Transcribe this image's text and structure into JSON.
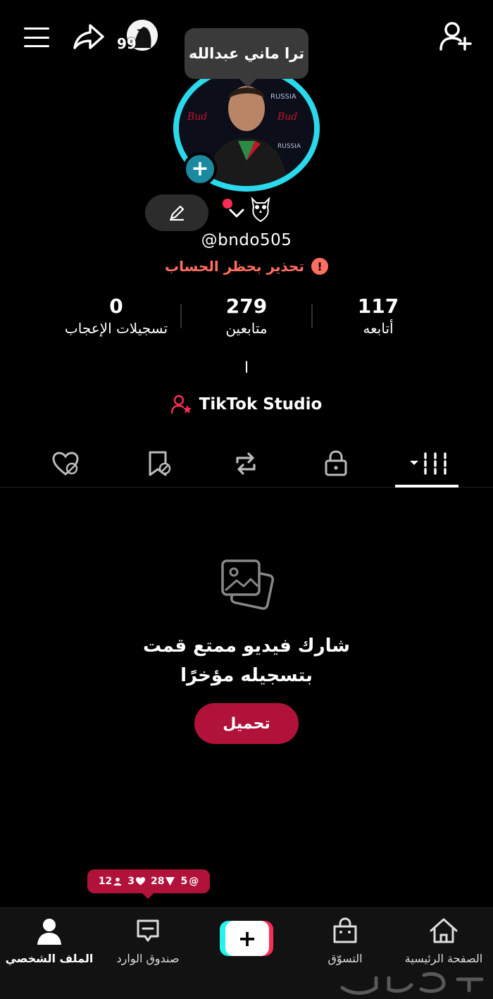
{
  "header": {
    "tooltip_text": "ترا ماني عبدالله",
    "badge_count": "99"
  },
  "profile": {
    "username": "@bndo505",
    "warning_text": "تحذير بحظر الحساب",
    "bio": "ا",
    "studio_label": "TikTok Studio"
  },
  "stats": [
    {
      "value": "0",
      "label": "تسجيلات الإعجاب"
    },
    {
      "value": "279",
      "label": "متابعين"
    },
    {
      "value": "117",
      "label": "أتابعه"
    }
  ],
  "tabs": {
    "active": "videos"
  },
  "empty_state": {
    "line1": "شارك فيديو ممتع قمت",
    "line2": "بتسجيله مؤخرًا",
    "button_label": "تحميل"
  },
  "notifications": {
    "mentions": "5",
    "comments": "28",
    "likes": "3",
    "followers": "12"
  },
  "bottom_nav": {
    "home": "الصفحة الرئيسية",
    "shop": "التسوّق",
    "inbox": "صندوق الوارد",
    "profile": "الملف الشخصي"
  },
  "colors": {
    "accent_red": "#b0123a",
    "ring_cyan": "#2bd9ec",
    "warning": "#ff6f61"
  }
}
